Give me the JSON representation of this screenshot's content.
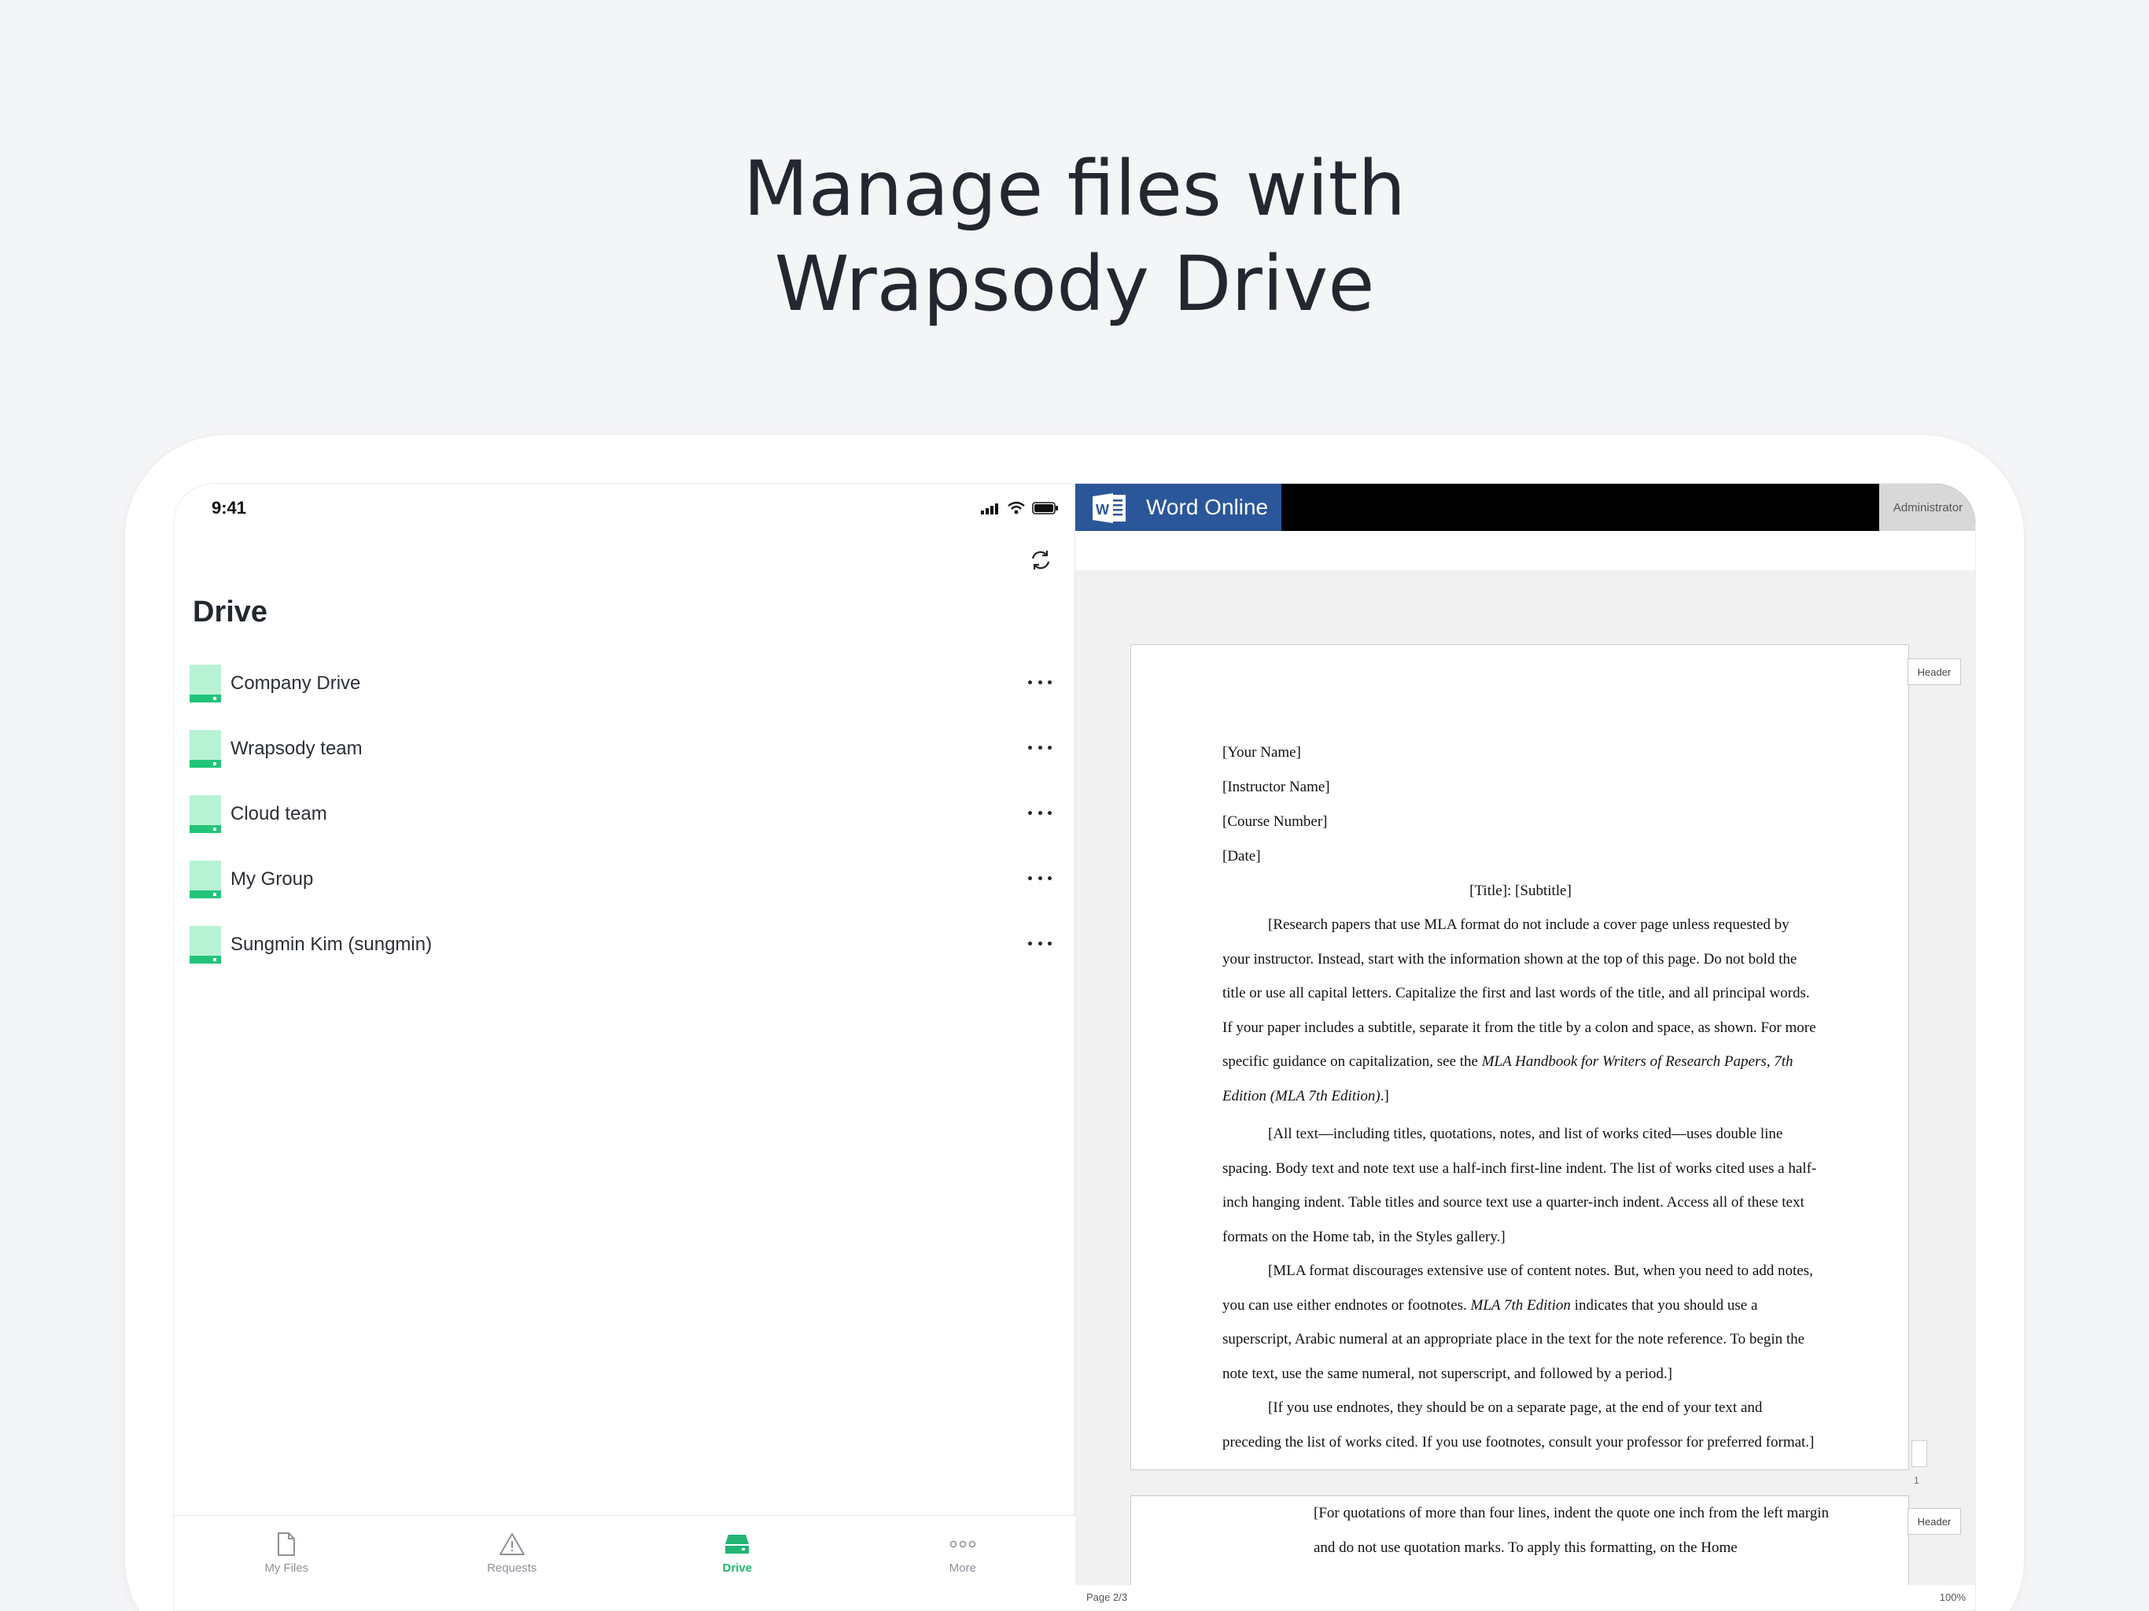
{
  "headline": {
    "line1": "Manage files with",
    "line2": "Wrapsody Drive"
  },
  "status_bar": {
    "time": "9:41"
  },
  "sidebar": {
    "title": "Drive",
    "items": [
      {
        "label": "Company Drive"
      },
      {
        "label": "Wrapsody team"
      },
      {
        "label": "Cloud team"
      },
      {
        "label": "My Group"
      },
      {
        "label": "Sungmin Kim (sungmin)"
      }
    ]
  },
  "tabs": [
    {
      "label": "My Files",
      "icon": "file-icon"
    },
    {
      "label": "Requests",
      "icon": "warning-icon"
    },
    {
      "label": "Drive",
      "icon": "drive-icon",
      "active": true
    },
    {
      "label": "More",
      "icon": "more-dots-icon"
    }
  ],
  "word": {
    "brand": "Word Online",
    "user": "Administrator",
    "header_tag": "Header",
    "page_marker": "1",
    "status_page": "Page 2/3",
    "status_zoom": "100%"
  },
  "document": {
    "your_name": "[Your Name]",
    "instructor": "[Instructor Name]",
    "course": "[Course Number]",
    "date": "[Date]",
    "title": "[Title]: [Subtitle]",
    "para1_a": "[Research papers that use MLA format do not include a cover page unless requested by your instructor. Instead, start with the information shown at the top of this page.  Do not bold the title or use all capital letters. Capitalize the first and last words of the title, and all principal words. If your paper includes a subtitle, separate it from the title by a colon and space, as shown. For more specific guidance on capitalization, see the ",
    "para1_em": "MLA Handbook for Writers of Research Papers, 7th Edition (MLA 7th Edition)",
    "para1_b": ".]",
    "para2": "[All text—including titles, quotations, notes, and list of works cited—uses double line spacing. Body text and note text use a half-inch first-line indent. The list of works cited uses a half-inch hanging indent. Table titles and source text use a quarter-inch indent. Access all of these text formats on the Home tab, in the Styles gallery.]",
    "para3_a": "[MLA format discourages extensive use of content notes. But, when you need to add notes, you can use either endnotes or footnotes. ",
    "para3_em": "MLA 7th Edition",
    "para3_b": " indicates that you should use a superscript, Arabic numeral at an appropriate place in the text for the note reference. To begin the note text, use the same numeral, not superscript, and followed by a period.]",
    "para4": "[If you use endnotes, they should be on a separate page, at the end of your text and preceding the list of works cited. If you use footnotes, consult your professor for preferred format.]",
    "para5": "[For quotations of more than four lines, indent the quote one inch from the left margin and do not use quotation marks. To apply this formatting, on the Home"
  },
  "colors": {
    "accent": "#22b573",
    "drive_icon": "#b8f2d4",
    "word_blue": "#2b579a"
  }
}
